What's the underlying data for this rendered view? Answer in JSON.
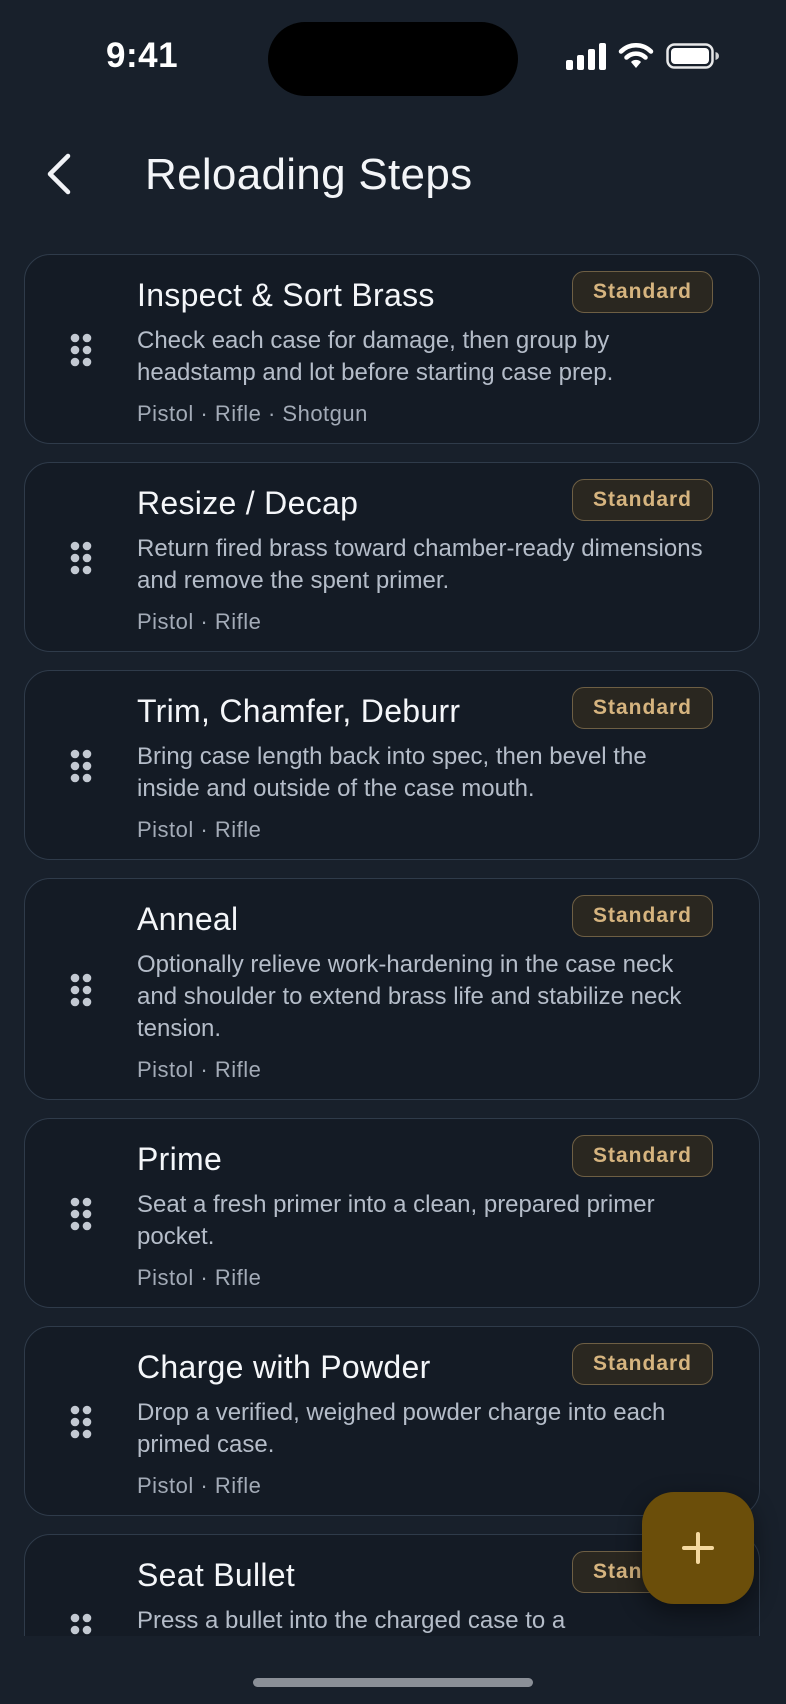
{
  "status_bar": {
    "time": "9:41"
  },
  "header": {
    "title": "Reloading Steps"
  },
  "steps": [
    {
      "title": "Inspect & Sort Brass",
      "badge": "Standard",
      "description": "Check each case for damage, then group by headstamp and lot before starting case prep.",
      "tags": "Pistol · Rifle · Shotgun"
    },
    {
      "title": "Resize / Decap",
      "badge": "Standard",
      "description": "Return fired brass toward chamber-ready dimensions and remove the spent primer.",
      "tags": "Pistol · Rifle"
    },
    {
      "title": "Trim, Chamfer, Deburr",
      "badge": "Standard",
      "description": "Bring case length back into spec, then bevel the inside and outside of the case mouth.",
      "tags": "Pistol · Rifle"
    },
    {
      "title": "Anneal",
      "badge": "Standard",
      "description": "Optionally relieve work-hardening in the case neck and shoulder to extend brass life and stabilize neck tension.",
      "tags": "Pistol · Rifle"
    },
    {
      "title": "Prime",
      "badge": "Standard",
      "description": "Seat a fresh primer into a clean, prepared primer pocket.",
      "tags": "Pistol · Rifle"
    },
    {
      "title": "Charge with Powder",
      "badge": "Standard",
      "description": "Drop a verified, weighed powder charge into each primed case.",
      "tags": "Pistol · Rifle"
    },
    {
      "title": "Seat Bullet",
      "badge": "Standard",
      "description": "Press a bullet into the charged case to a",
      "tags": ""
    }
  ],
  "fab": {
    "icon": "plus-icon",
    "color": "#6b4e0a"
  },
  "colors": {
    "background": "#18202b",
    "card": "#141b25",
    "card_border": "#2f3b4a",
    "badge_text": "#d6b47f",
    "accent": "#6b4e0a"
  }
}
